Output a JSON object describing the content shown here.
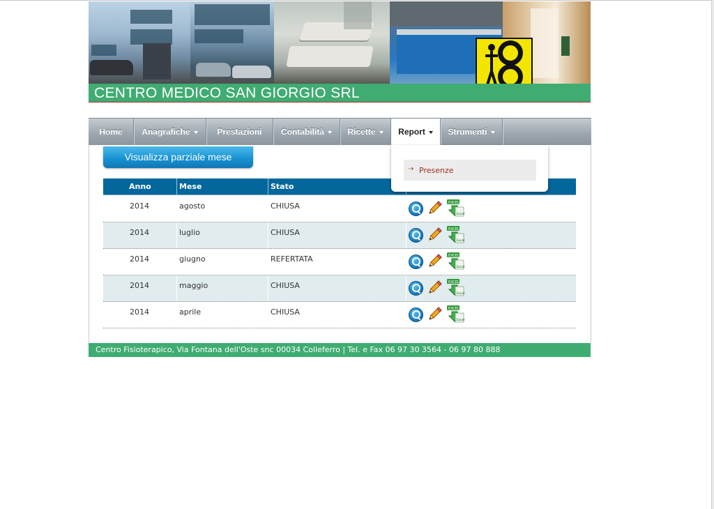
{
  "header": {
    "site_title": "CENTRO MEDICO SAN GIORGIO SRL"
  },
  "nav": {
    "items": [
      {
        "label": "Home",
        "dropdown": false
      },
      {
        "label": "Anagrafiche",
        "dropdown": true
      },
      {
        "label": "Prestazioni",
        "dropdown": false
      },
      {
        "label": "Contabilità",
        "dropdown": true
      },
      {
        "label": "Ricette",
        "dropdown": true
      },
      {
        "label": "Report",
        "dropdown": true,
        "active": true
      },
      {
        "label": "Strumenti",
        "dropdown": true
      }
    ],
    "report_menu": {
      "items": [
        {
          "label": "Presenze",
          "icon": "arrow-right-icon"
        }
      ]
    }
  },
  "main": {
    "month_button_label": "Visualizza parziale mese",
    "table": {
      "headers": [
        "Anno",
        "Mese",
        "Stato",
        ""
      ],
      "rows": [
        {
          "anno": "2014",
          "mese": "agosto",
          "stato": "CHIUSA"
        },
        {
          "anno": "2014",
          "mese": "luglio",
          "stato": "CHIUSA"
        },
        {
          "anno": "2014",
          "mese": "giugno",
          "stato": "REFERTATA"
        },
        {
          "anno": "2014",
          "mese": "maggio",
          "stato": "CHIUSA"
        },
        {
          "anno": "2014",
          "mese": "aprile",
          "stato": "CHIUSA"
        }
      ],
      "row_actions": [
        "view-icon",
        "edit-pencil-icon",
        "excel-export-icon"
      ]
    }
  },
  "footer": {
    "text": "Centro Fisioterapico, Via Fontana dell'Oste snc 00034 Colleferro | Tel. e Fax 06 97 30 3564 - 06 97 80 888"
  },
  "colors": {
    "brand_green": "#3fac72",
    "table_header": "#04679c",
    "button_blue": "#1993d3",
    "alt_row": "#e0ecee",
    "dropdown_link": "#a0301e"
  }
}
